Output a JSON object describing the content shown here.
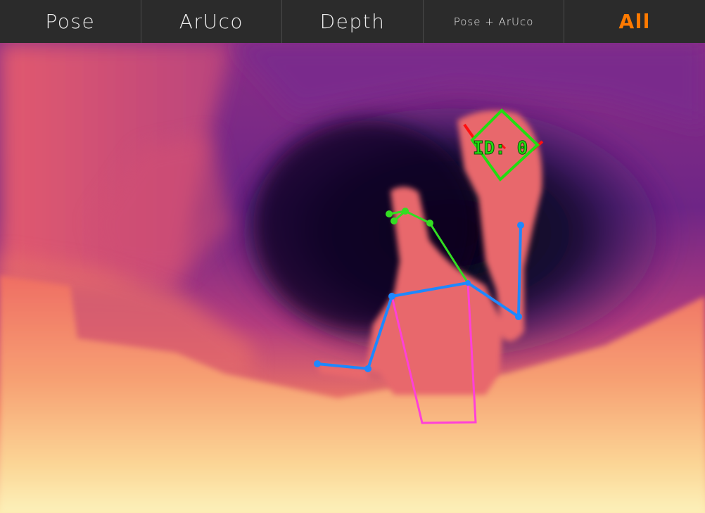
{
  "tabs": [
    {
      "id": "pose",
      "label": "Pose",
      "active": false
    },
    {
      "id": "aruco",
      "label": "ArUco",
      "active": false
    },
    {
      "id": "depth",
      "label": "Depth",
      "active": false
    },
    {
      "id": "pose-aruco",
      "label": "Pose + ArUco",
      "active": false
    },
    {
      "id": "all",
      "label": "All",
      "active": true
    }
  ],
  "colors": {
    "tab_text": "#ececec",
    "tab_active": "#ff7a00",
    "tabbar_bg": "#2b2b2b",
    "skeleton_face": "#33dd22",
    "skeleton_limbs": "#1e88ff",
    "skeleton_torso": "#ff40d8",
    "marker_outline": "#22dd11",
    "marker_axis": "#ff1010"
  },
  "marker": {
    "label": "ID: 0"
  }
}
